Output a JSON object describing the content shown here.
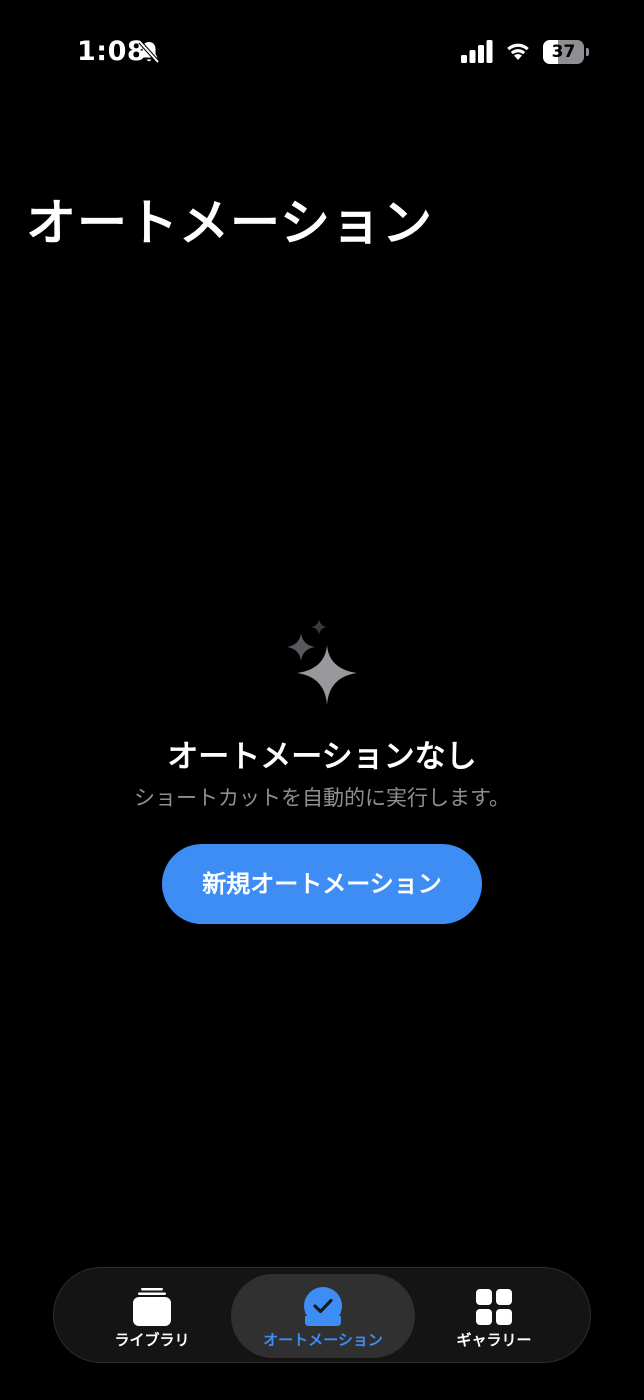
{
  "status_bar": {
    "time": "1:08",
    "battery_level": "37",
    "battery_fraction": 0.37,
    "icons": [
      "bell-slash-icon",
      "signal-icon",
      "wifi-icon",
      "battery-icon"
    ]
  },
  "page": {
    "title": "オートメーション"
  },
  "empty_state": {
    "icon": "sparkles-icon",
    "title": "オートメーションなし",
    "subtitle": "ショートカットを自動的に実行します。",
    "button_label": "新規オートメーション"
  },
  "tab_bar": {
    "items": [
      {
        "label": "ライブラリ",
        "icon": "library-stack-icon",
        "active": false
      },
      {
        "label": "オートメーション",
        "icon": "automation-clock-icon",
        "active": true
      },
      {
        "label": "ギャラリー",
        "icon": "gallery-grid-icon",
        "active": false
      }
    ]
  },
  "colors": {
    "background": "#000000",
    "accent": "#3E8DF5",
    "secondary_text": "#8E8E93",
    "tab_bar_bg": "#141414",
    "tab_active_bg": "#303030"
  }
}
